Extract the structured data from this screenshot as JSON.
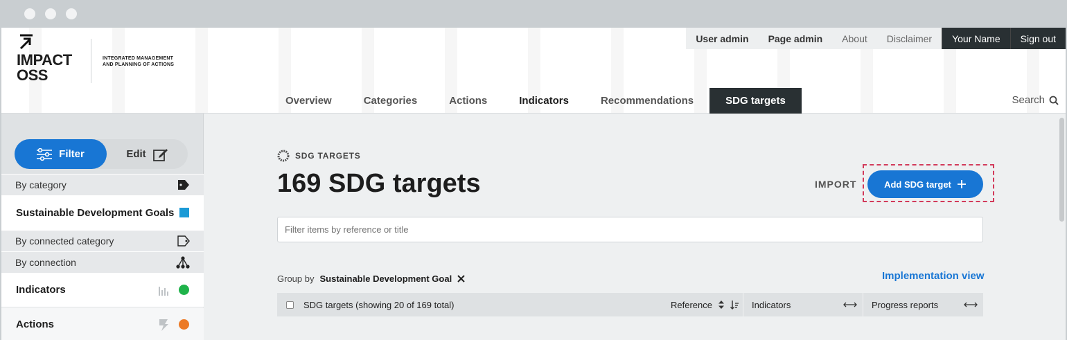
{
  "brand": {
    "logo_line1": "IMPACT",
    "logo_line2": "OSS",
    "tagline_line1": "INTEGRATED MANAGEMENT",
    "tagline_line2": "AND PLANNING OF ACTIONS"
  },
  "topnav": {
    "user_admin": "User admin",
    "page_admin": "Page admin",
    "about": "About",
    "disclaimer": "Disclaimer",
    "your_name": "Your Name",
    "sign_out": "Sign out"
  },
  "mainnav": {
    "overview": "Overview",
    "categories": "Categories",
    "actions": "Actions",
    "indicators": "Indicators",
    "recommendations": "Recommendations",
    "sdg_targets": "SDG targets",
    "search": "Search"
  },
  "sidebar": {
    "filter_label": "Filter",
    "edit_label": "Edit",
    "by_category": "By category",
    "sdg_goals": "Sustainable Development Goals",
    "by_connected_category": "By connected category",
    "by_connection": "By connection",
    "indicators": "Indicators",
    "actions": "Actions",
    "colors": {
      "sdg": "#1b9ad6",
      "indicators": "#1fb34a",
      "actions": "#ec7a26"
    }
  },
  "main": {
    "kicker": "SDG TARGETS",
    "title": "169 SDG targets",
    "import_label": "IMPORT",
    "add_label": "Add SDG target",
    "filter_placeholder": "Filter items by reference or title",
    "group_by_label": "Group by",
    "group_by_value": "Sustainable Development Goal",
    "implementation_view": "Implementation view",
    "table": {
      "title_col": "SDG targets (showing 20 of 169 total)",
      "reference_col": "Reference",
      "indicators_col": "Indicators",
      "progress_col": "Progress reports"
    }
  },
  "colors": {
    "accent": "#1876d4",
    "dark": "#293033",
    "highlight": "#d23a5a"
  }
}
